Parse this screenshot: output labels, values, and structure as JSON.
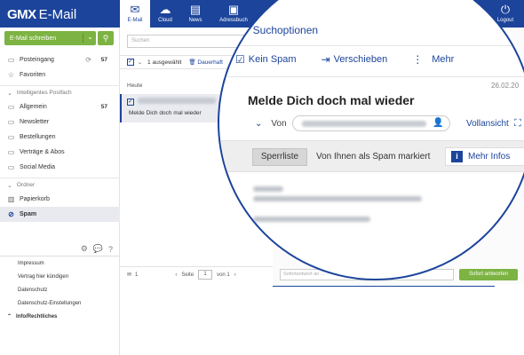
{
  "brand": {
    "logo_bold": "GMX",
    "logo_text": "E-Mail"
  },
  "topnav": [
    {
      "label": "E-Mail",
      "icon": "mail-icon",
      "glyph": "✉"
    },
    {
      "label": "Cloud",
      "icon": "cloud-icon",
      "glyph": "☁"
    },
    {
      "label": "News",
      "icon": "news-icon",
      "glyph": "▤"
    },
    {
      "label": "Adressbuch",
      "icon": "addressbook-icon",
      "glyph": "▣"
    }
  ],
  "topright": [
    {
      "label": "",
      "icon": "user-icon",
      "glyph": "●"
    },
    {
      "label": "Logout",
      "icon": "power-icon",
      "glyph": "⏻"
    }
  ],
  "sidebar": {
    "compose_label": "E-Mail schreiben",
    "items_top": [
      {
        "label": "Posteingang",
        "count": "57",
        "icon": "inbox-icon",
        "glyph": "▭"
      },
      {
        "label": "Favoriten",
        "count": "",
        "icon": "star-icon",
        "glyph": "☆"
      }
    ],
    "section_smart": "Intelligentes Postfach",
    "items_smart": [
      {
        "label": "Allgemein",
        "count": "57",
        "icon": "general-icon",
        "glyph": "▭"
      },
      {
        "label": "Newsletter",
        "count": "",
        "icon": "newsletter-icon",
        "glyph": "▭"
      },
      {
        "label": "Bestellungen",
        "count": "",
        "icon": "cart-icon",
        "glyph": "▭"
      },
      {
        "label": "Verträge & Abos",
        "count": "",
        "icon": "contract-icon",
        "glyph": "▭"
      },
      {
        "label": "Social Media",
        "count": "",
        "icon": "social-icon",
        "glyph": "▭"
      }
    ],
    "section_folders": "Ordner",
    "items_folders": [
      {
        "label": "Papierkorb",
        "icon": "trash-icon",
        "glyph": "🗑"
      },
      {
        "label": "Spam",
        "icon": "spam-icon",
        "glyph": "⊘"
      }
    ],
    "footer_links": [
      "Impressum",
      "Vertrag hier kündigen",
      "Datenschutz",
      "Datenschutz-Einstellungen"
    ],
    "footer_bold": "Info/Rechtliches"
  },
  "list": {
    "search_placeholder": "Suchen",
    "selected_text": "1 ausgewählt",
    "delete_label": "Dauerhaft",
    "group_today": "Heute",
    "mail_subject": "Melde Dich doch mal wieder",
    "footer_count": "1",
    "page_label": "Seite",
    "page_value": "1",
    "page_of": "von 1"
  },
  "reply": {
    "placeholder": "Sofortantwort an ...",
    "button": "Sofort antworten"
  },
  "magnifier": {
    "search_options": "Suchoptionen",
    "tools": [
      {
        "label": "Kein Spam",
        "icon": "not-spam-icon",
        "glyph": "☑"
      },
      {
        "label": "Verschieben",
        "icon": "move-icon",
        "glyph": "⇥"
      },
      {
        "label": "Mehr",
        "icon": "more-icon",
        "glyph": "⋮"
      }
    ],
    "date": "26.02.20",
    "subject": "Melde Dich doch mal wieder",
    "from_label": "Von",
    "full_view": "Vollansicht",
    "blocklist_button": "Sperrliste",
    "spam_message": "Von Ihnen als Spam markiert",
    "more_info": "Mehr Infos"
  }
}
